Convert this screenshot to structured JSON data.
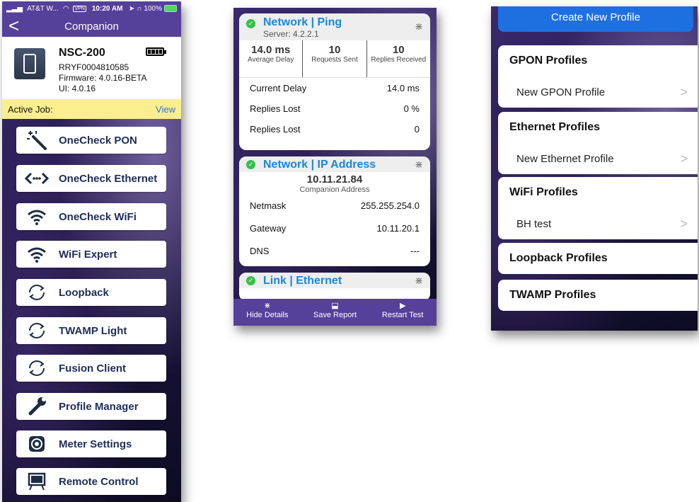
{
  "screen1": {
    "status": {
      "carrier": "AT&T W...",
      "vpn": "VPN",
      "time": "10:20 AM",
      "battery": "100%"
    },
    "nav": {
      "back": "<",
      "title": "Companion"
    },
    "device": {
      "name": "NSC-200",
      "serial": "RRYF0004810585",
      "firmware": "Firmware: 4.0.16-BETA",
      "ui": "UI: 4.0.16"
    },
    "active_job": {
      "label": "Active Job:",
      "link": "View"
    },
    "menu": [
      {
        "label": "OneCheck PON",
        "icon": "magic-wand-icon"
      },
      {
        "label": "OneCheck Ethernet",
        "icon": "ethernet-arrows-icon"
      },
      {
        "label": "OneCheck WiFi",
        "icon": "wifi-icon"
      },
      {
        "label": "WiFi Expert",
        "icon": "wifi-icon"
      },
      {
        "label": "Loopback",
        "icon": "loop-arrows-icon"
      },
      {
        "label": "TWAMP Light",
        "icon": "loop-arrows-icon"
      },
      {
        "label": "Fusion Client",
        "icon": "loop-arrows-icon"
      },
      {
        "label": "Profile Manager",
        "icon": "wrench-icon"
      },
      {
        "label": "Meter Settings",
        "icon": "gear-icon"
      },
      {
        "label": "Remote Control",
        "icon": "easel-icon"
      }
    ]
  },
  "screen2": {
    "ping": {
      "title": "Network | Ping",
      "server": "Server: 4.2.2.1",
      "stats": [
        {
          "value": "14.0 ms",
          "label": "Average Delay"
        },
        {
          "value": "10",
          "label": "Requests Sent"
        },
        {
          "value": "10",
          "label": "Replies Received"
        }
      ],
      "rows": [
        {
          "label": "Current Delay",
          "value": "14.0 ms"
        },
        {
          "label": "Replies Lost",
          "value": "0 %"
        },
        {
          "label": "Replies Lost",
          "value": "0"
        }
      ]
    },
    "ip": {
      "title": "Network | IP Address",
      "address": "10.11.21.84",
      "address_label": "Companion Address",
      "rows": [
        {
          "label": "Netmask",
          "value": "255.255.254.0"
        },
        {
          "label": "Gateway",
          "value": "10.11.20.1"
        },
        {
          "label": "DNS",
          "value": "---"
        }
      ]
    },
    "link": {
      "title": "Link | Ethernet"
    },
    "tabs": [
      {
        "label": "Hide Details",
        "icon": "collapse-icon"
      },
      {
        "label": "Save Report",
        "icon": "save-icon"
      },
      {
        "label": "Restart Test",
        "icon": "play-icon"
      }
    ]
  },
  "screen3": {
    "create_label": "Create New Profile",
    "groups": [
      {
        "title": "GPON Profiles",
        "items": [
          "New GPON Profile"
        ]
      },
      {
        "title": "Ethernet Profiles",
        "items": [
          "New Ethernet Profile"
        ]
      },
      {
        "title": "WiFi Profiles",
        "items": [
          "BH test"
        ]
      },
      {
        "title": "Loopback Profiles",
        "items": []
      },
      {
        "title": "TWAMP Profiles",
        "items": []
      }
    ]
  }
}
